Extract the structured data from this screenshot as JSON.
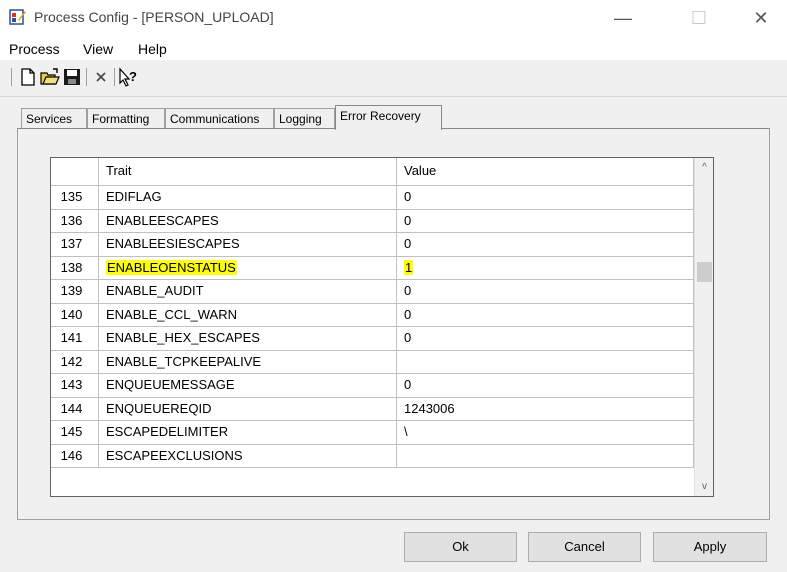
{
  "window": {
    "title": "Process Config - [PERSON_UPLOAD]",
    "minimize_label": "—",
    "maximize_label": "☐",
    "close_label": "✕"
  },
  "menu": [
    "Process",
    "View",
    "Help"
  ],
  "toolbar": [
    "new-icon",
    "open-icon",
    "save-icon",
    "delete-icon",
    "help-pointer-icon"
  ],
  "tabs": [
    "Services",
    "Formatting",
    "Communications",
    "Logging",
    "Error Recovery"
  ],
  "active_tab": "Error Recovery",
  "grid": {
    "headers": {
      "num": "",
      "trait": "Trait",
      "value": "Value"
    },
    "rows": [
      {
        "num": "135",
        "trait": "EDIFLAG",
        "value": "0"
      },
      {
        "num": "136",
        "trait": "ENABLEESCAPES",
        "value": "0"
      },
      {
        "num": "137",
        "trait": "ENABLEESIESCAPES",
        "value": "0"
      },
      {
        "num": "138",
        "trait": "ENABLEOENSTATUS",
        "value": "1"
      },
      {
        "num": "139",
        "trait": "ENABLE_AUDIT",
        "value": "0"
      },
      {
        "num": "140",
        "trait": "ENABLE_CCL_WARN",
        "value": "0"
      },
      {
        "num": "141",
        "trait": "ENABLE_HEX_ESCAPES",
        "value": "0"
      },
      {
        "num": "142",
        "trait": "ENABLE_TCPKEEPALIVE",
        "value": ""
      },
      {
        "num": "143",
        "trait": "ENQUEUEMESSAGE",
        "value": "0"
      },
      {
        "num": "144",
        "trait": "ENQUEUEREQID",
        "value": "1243006"
      },
      {
        "num": "145",
        "trait": "ESCAPEDELIMITER",
        "value": "\\"
      },
      {
        "num": "146",
        "trait": "ESCAPEEXCLUSIONS",
        "value": ""
      }
    ],
    "highlight_color": "#ffff00",
    "scroll_up": "^",
    "scroll_down": "v"
  },
  "buttons": {
    "ok": "Ok",
    "cancel": "Cancel",
    "apply": "Apply"
  }
}
